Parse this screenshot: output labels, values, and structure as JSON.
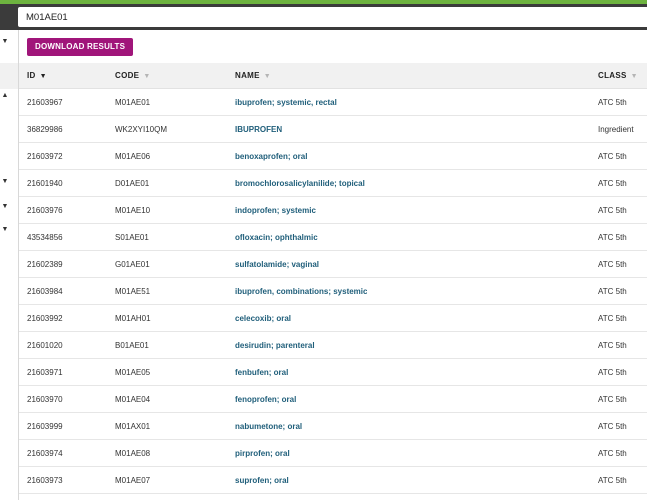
{
  "search": {
    "value": "M01AE01"
  },
  "toolbar": {
    "download_label": "DOWNLOAD RESULTS"
  },
  "left_panel": {
    "carets": [
      "▼",
      "▲",
      "▼",
      "▼",
      "▼"
    ]
  },
  "table": {
    "columns": [
      {
        "label": "ID",
        "sort_icon": "▼"
      },
      {
        "label": "CODE",
        "sort_icon": "▼"
      },
      {
        "label": "NAME",
        "sort_icon": "▼"
      },
      {
        "label": "CLASS",
        "sort_icon": "▼"
      }
    ],
    "rows": [
      {
        "id": "21603967",
        "code": "M01AE01",
        "name": "ibuprofen; systemic, rectal",
        "class": "ATC 5th"
      },
      {
        "id": "36829986",
        "code": "WK2XYI10QM",
        "name": "IBUPROFEN",
        "class": "Ingredient"
      },
      {
        "id": "21603972",
        "code": "M01AE06",
        "name": "benoxaprofen; oral",
        "class": "ATC 5th"
      },
      {
        "id": "21601940",
        "code": "D01AE01",
        "name": "bromochlorosalicylanilide; topical",
        "class": "ATC 5th"
      },
      {
        "id": "21603976",
        "code": "M01AE10",
        "name": "indoprofen; systemic",
        "class": "ATC 5th"
      },
      {
        "id": "43534856",
        "code": "S01AE01",
        "name": "ofloxacin; ophthalmic",
        "class": "ATC 5th"
      },
      {
        "id": "21602389",
        "code": "G01AE01",
        "name": "sulfatolamide; vaginal",
        "class": "ATC 5th"
      },
      {
        "id": "21603984",
        "code": "M01AE51",
        "name": "ibuprofen, combinations; systemic",
        "class": "ATC 5th"
      },
      {
        "id": "21603992",
        "code": "M01AH01",
        "name": "celecoxib; oral",
        "class": "ATC 5th"
      },
      {
        "id": "21601020",
        "code": "B01AE01",
        "name": "desirudin; parenteral",
        "class": "ATC 5th"
      },
      {
        "id": "21603971",
        "code": "M01AE05",
        "name": "fenbufen; oral",
        "class": "ATC 5th"
      },
      {
        "id": "21603970",
        "code": "M01AE04",
        "name": "fenoprofen; oral",
        "class": "ATC 5th"
      },
      {
        "id": "21603999",
        "code": "M01AX01",
        "name": "nabumetone; oral",
        "class": "ATC 5th"
      },
      {
        "id": "21603974",
        "code": "M01AE08",
        "name": "pirprofen; oral",
        "class": "ATC 5th"
      },
      {
        "id": "21603973",
        "code": "M01AE07",
        "name": "suprofen; oral",
        "class": "ATC 5th"
      }
    ]
  },
  "colors": {
    "accent_bar": "#6db33f",
    "download_button": "#a0157a",
    "link_text": "#1f5e7a",
    "header_bg": "#f1f1f1"
  }
}
